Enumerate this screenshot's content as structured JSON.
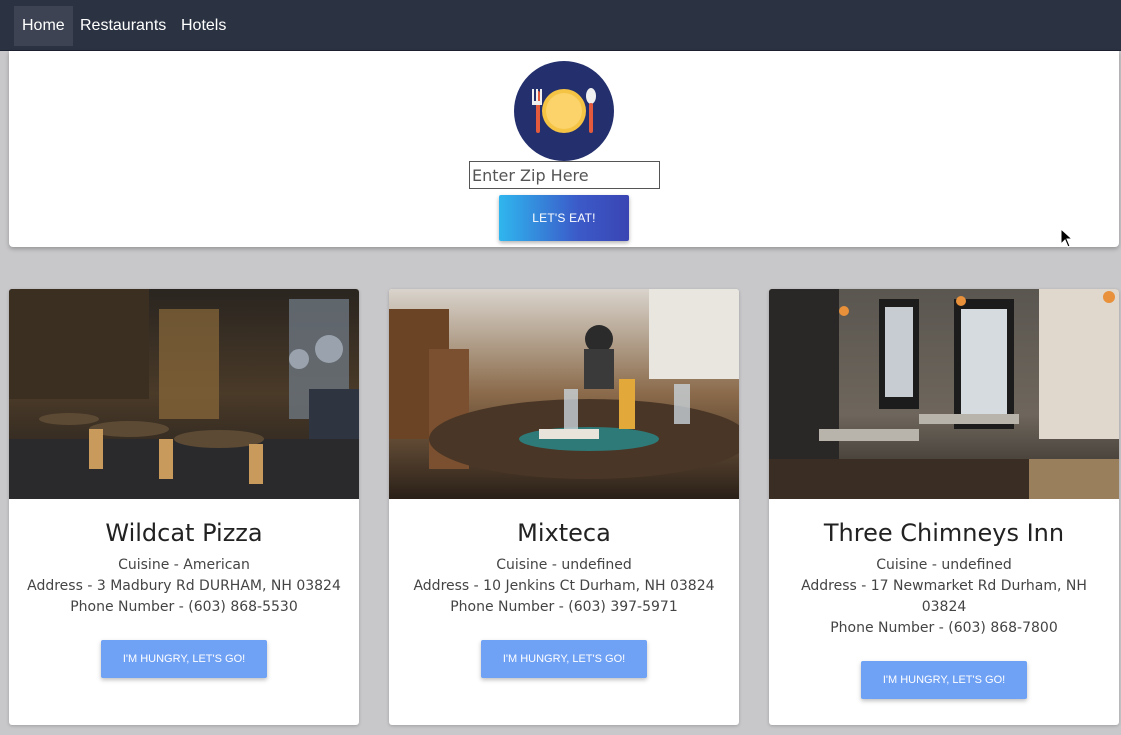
{
  "nav": {
    "items": [
      {
        "label": "Home",
        "active": true
      },
      {
        "label": "Restaurants",
        "active": false
      },
      {
        "label": "Hotels",
        "active": false
      }
    ]
  },
  "hero": {
    "logo_icon": "plate-fork-spoon-icon",
    "zip_placeholder": "Enter Zip Here",
    "zip_value": "",
    "button_label": "LET'S EAT!"
  },
  "restaurants": [
    {
      "name": "Wildcat Pizza",
      "cuisine": "Cuisine - American",
      "address": "Address - 3 Madbury Rd DURHAM, NH 03824",
      "phone": "Phone Number - (603) 868-5530",
      "button_label": "I'M HUNGRY, LET'S GO!",
      "image_icon": "restaurant-interior-photo"
    },
    {
      "name": "Mixteca",
      "cuisine": "Cuisine - undefined",
      "address": "Address - 10 Jenkins Ct Durham, NH 03824",
      "phone": "Phone Number - (603) 397-5971",
      "button_label": "I'M HUNGRY, LET'S GO!",
      "image_icon": "restaurant-table-photo"
    },
    {
      "name": "Three Chimneys Inn",
      "cuisine": "Cuisine - undefined",
      "address": "Address - 17 Newmarket Rd Durham, NH 03824",
      "phone": "Phone Number - (603) 868-7800",
      "button_label": "I'M HUNGRY, LET'S GO!",
      "image_icon": "dining-room-photo"
    }
  ],
  "colors": {
    "navbar": "#2b3242",
    "page_bg": "#c8c7c9",
    "card_button": "#6fa1f5",
    "hero_button_start": "#2fb6ee",
    "hero_button_end": "#3a45b3"
  }
}
